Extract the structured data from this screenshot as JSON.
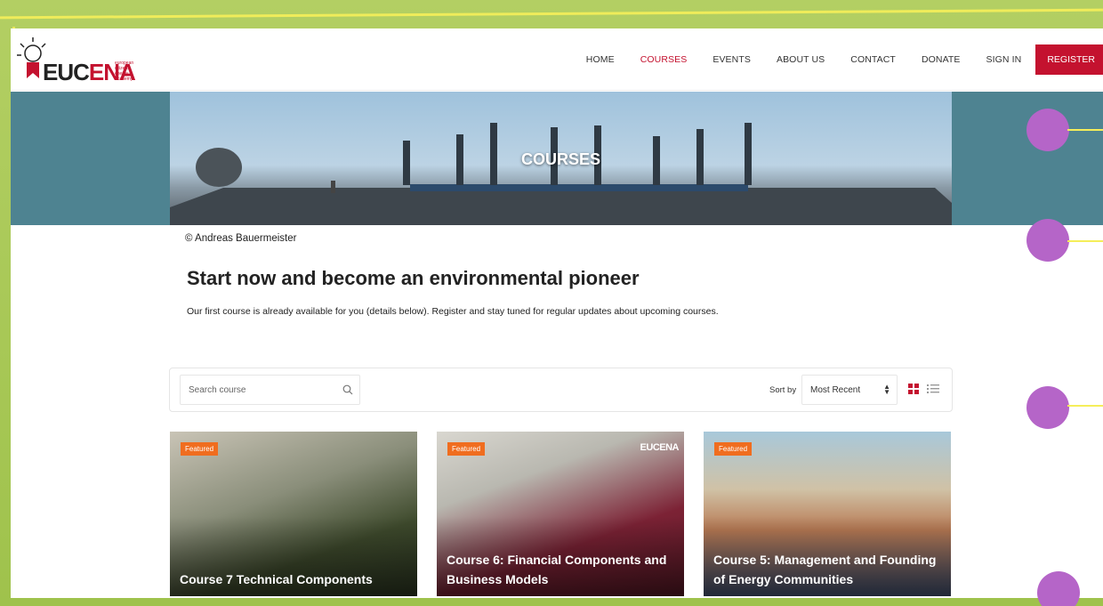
{
  "brand": {
    "name_part1": "EUC",
    "name_part2": "ENA",
    "subtitle": "european citizens energy academy"
  },
  "nav": {
    "items": [
      "HOME",
      "COURSES",
      "EVENTS",
      "ABOUT US",
      "CONTACT",
      "DONATE",
      "SIGN IN"
    ],
    "active": "COURSES",
    "register_label": "REGISTER"
  },
  "hero": {
    "title": "COURSES"
  },
  "credit": "© Andreas Bauermeister",
  "headline": "Start now and become an environmental pioneer",
  "intro": "Our first course is already available for you (details below).  Register and stay tuned for regular updates about upcoming courses.",
  "filter": {
    "search_placeholder": "Search course",
    "sort_label": "Sort by",
    "sort_value": "Most Recent"
  },
  "cards": [
    {
      "badge": "Featured",
      "title": "Course 7 Technical Components"
    },
    {
      "badge": "Featured",
      "title": "Course 6: Financial Components and Business Models",
      "logo": "EUCENA"
    },
    {
      "badge": "Featured",
      "title": "Course 5: Management and Founding of Energy Communities"
    }
  ],
  "colors": {
    "accent": "#c4122f",
    "badge": "#f06d1f",
    "hero_band": "#4e8391",
    "overlay_dot": "#b565c8"
  }
}
